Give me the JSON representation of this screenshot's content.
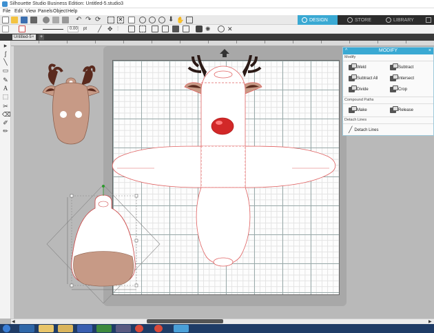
{
  "window": {
    "title": "Silhouette Studio Business Edition: Untitled-5.studio3"
  },
  "menu": [
    "File",
    "Edit",
    "View",
    "Panels",
    "Object",
    "Help"
  ],
  "modes": [
    {
      "label": "DESIGN",
      "active": true
    },
    {
      "label": "STORE",
      "active": false
    },
    {
      "label": "LIBRARY",
      "active": false
    }
  ],
  "toolbar2": {
    "line_width": "0.00",
    "unit": "pt"
  },
  "tabs": {
    "doc_tab": "Untitled-5",
    "close": "×",
    "add": "+"
  },
  "tools": [
    "▸",
    "ʃ",
    "╲",
    "▭",
    "✎",
    "A",
    "⬚",
    "✂",
    "⌫",
    "✐",
    "✏"
  ],
  "modify_panel": {
    "title": "MODIFY",
    "collapse": "^",
    "close": "×",
    "sections": {
      "modify": "Modify",
      "compound": "Compound Paths",
      "detach": "Detach Lines"
    },
    "buttons": {
      "weld": "Weld",
      "subtract": "Subtract",
      "subtract_all": "Subtract All",
      "intersect": "Intersect",
      "divide": "Divide",
      "crop": "Crop",
      "make": "Make",
      "release": "Release",
      "detach_lines": "Detach Lines"
    }
  },
  "colors": {
    "accent": "#3aa9d3",
    "reindeer_brown": "#c79a86",
    "antler": "#5a2a1e",
    "nose": "#d22828",
    "cut_line": "#e06060"
  },
  "icons": {
    "feed": "up-arrow-icon",
    "store": "cloud-icon",
    "library": "book-icon"
  }
}
